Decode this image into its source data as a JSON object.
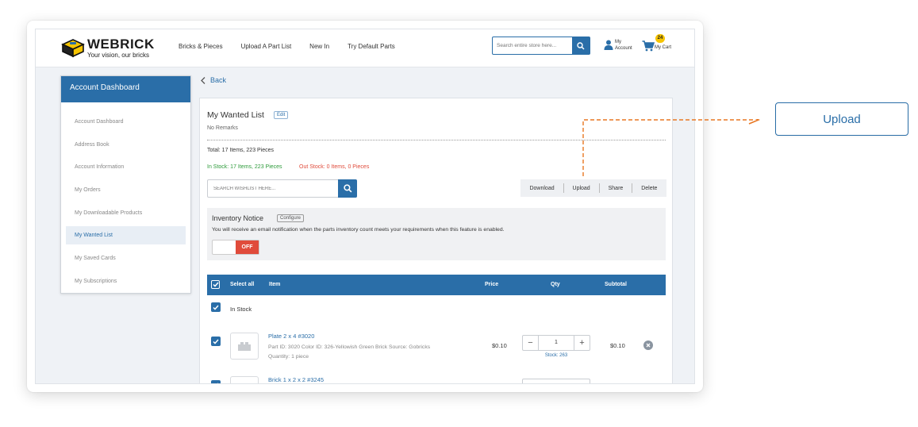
{
  "brand": {
    "name": "WEBRICK",
    "tagline": "Your vision, our bricks"
  },
  "nav": [
    "Bricks & Pieces",
    "Upload A Part List",
    "New In",
    "Try Default Parts"
  ],
  "header_search": {
    "placeholder": "Search entire store here..."
  },
  "account": {
    "line1": "My",
    "line2": "Account"
  },
  "cart": {
    "count": "24",
    "label": "My Cart"
  },
  "sidebar": {
    "title": "Account Dashboard",
    "items": [
      {
        "label": "Account Dashboard",
        "active": false
      },
      {
        "label": "Address Book",
        "active": false
      },
      {
        "label": "Account Information",
        "active": false
      },
      {
        "label": "My Orders",
        "active": false
      },
      {
        "label": "My Downloadable Products",
        "active": false
      },
      {
        "label": "My Wanted List",
        "active": true
      },
      {
        "label": "My Saved Cards",
        "active": false
      },
      {
        "label": "My Subscriptions",
        "active": false
      }
    ]
  },
  "back_label": "Back",
  "wanted": {
    "title": "My Wanted List",
    "edit": "Edit",
    "remarks": "No Remarks",
    "total": "Total: 17 Items, 223 Pieces",
    "in_stock": "In Stock: 17 Items, 223 Pieces",
    "out_stock": "Out Stock: 0 Items, 0 Pieces",
    "search_placeholder": "SEARCH WISHLIST HERE...",
    "actions": {
      "download": "Download",
      "upload": "Upload",
      "share": "Share",
      "delete": "Delete"
    }
  },
  "notice": {
    "title": "Inventory Notice",
    "configure": "Configure",
    "text": "You will receive an email notification when the parts inventory count meets your requirements when this feature is enabled.",
    "toggle": "OFF"
  },
  "table": {
    "headers": {
      "select_all": "Select all",
      "item": "Item",
      "price": "Price",
      "qty": "Qty",
      "subtotal": "Subtotal"
    },
    "group": "In Stock",
    "rows": [
      {
        "name": "Plate 2 x 4 #3020",
        "meta1": "Part ID: 3020  Color ID: 326-Yellowish Green  Brick Source: Gobricks",
        "meta2": "Quantity: 1 piece",
        "price": "$0.10",
        "qty": "1",
        "stock": "Stock: 263",
        "subtotal": "$0.10"
      },
      {
        "name": "Brick 1 x 2 x 2 #3245"
      }
    ]
  },
  "callout": {
    "label": "Upload",
    "color": "#e87722"
  },
  "colors": {
    "primary": "#2a6ea8",
    "in_stock": "#2e9b3b",
    "out_stock": "#e04b3b",
    "badge": "#f6c400"
  }
}
